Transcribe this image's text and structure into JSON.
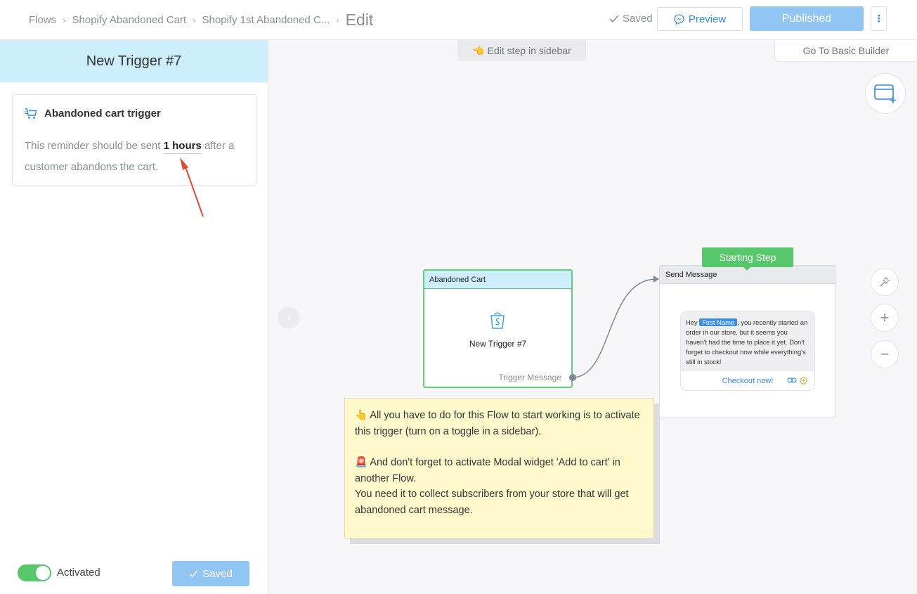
{
  "breadcrumbs": {
    "items": [
      "Flows",
      "Shopify Abandoned Cart",
      "Shopify 1st Abandoned C..."
    ],
    "current": "Edit"
  },
  "header": {
    "saved_status": "Saved",
    "preview_label": "Preview",
    "published_label": "Published",
    "more_icon": "kebab-icon"
  },
  "sidebar": {
    "title": "New Trigger #7",
    "card": {
      "title": "Abandoned cart trigger",
      "text_before": "This reminder should be sent ",
      "hours_value": "1 hours",
      "text_after": " after a customer abandons the cart."
    },
    "footer": {
      "toggle_label": "Activated",
      "saved_label": "Saved"
    }
  },
  "canvas": {
    "edit_hint": "Edit step in sidebar",
    "basic_builder_label": "Go To Basic Builder",
    "trigger_node": {
      "header": "Abandoned Cart",
      "name": "New Trigger #7",
      "output_label": "Trigger Message"
    },
    "starting_step_label": "Starting Step",
    "message_node": {
      "header": "Send Message",
      "text_before": "Hey ",
      "name_tag": "First Name",
      "text_after": ", you recently started an order in our store, but it seems you haven't had the time to place it yet. Don't forget to checkout now while everything's still in stock!",
      "button_label": "Checkout now!"
    },
    "note": {
      "line1": "👆 All you have to do for this Flow to start working is to activate this trigger (turn on a toggle in a sidebar).",
      "line2": "🚨 And don't forget to activate Modal widget 'Add to cart' in another Flow.",
      "line3": "You need it to collect subscribers from your store that will get abandoned cart message."
    }
  },
  "colors": {
    "accent_blue": "#2e8ae6",
    "published_bg": "#90c5f4",
    "green": "#57c76b",
    "sidebar_header_bg": "#cdeefd",
    "note_bg": "#fff9cc"
  }
}
